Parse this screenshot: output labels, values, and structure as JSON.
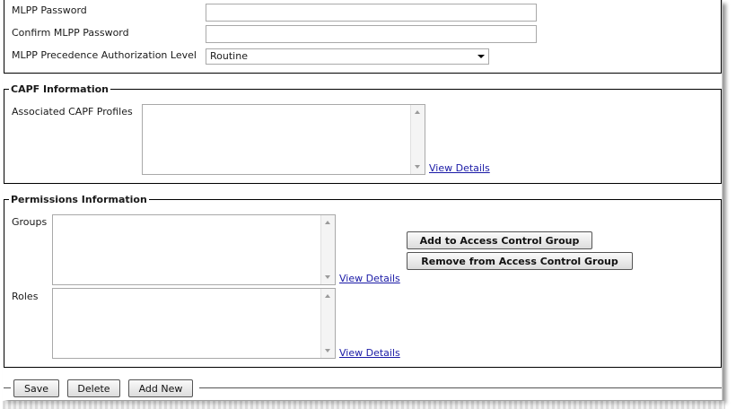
{
  "mlpp": {
    "password_label": "MLPP Password",
    "confirm_password_label": "Confirm MLPP Password",
    "precedence_label": "MLPP Precedence Authorization Level",
    "precedence_value": "Routine"
  },
  "capf": {
    "legend": "CAPF Information",
    "profiles_label": "Associated CAPF Profiles",
    "view_details": "View Details"
  },
  "permissions": {
    "legend": "Permissions Information",
    "groups_label": "Groups",
    "groups_view_details": "View Details",
    "roles_label": "Roles",
    "roles_view_details": "View Details",
    "add_button": "Add to Access Control Group",
    "remove_button": "Remove from Access Control Group"
  },
  "footer": {
    "save": "Save",
    "delete": "Delete",
    "add_new": "Add New"
  }
}
